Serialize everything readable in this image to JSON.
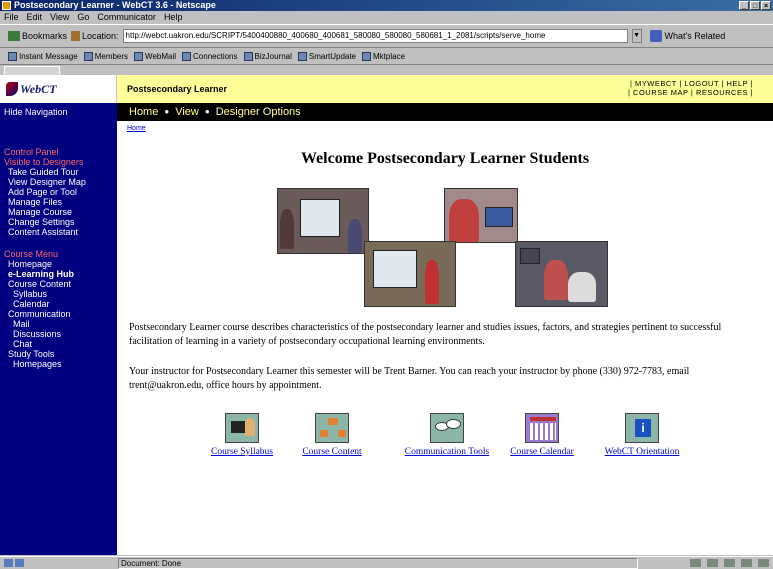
{
  "window": {
    "title": "Postsecondary Learner - WebCT 3.6 - Netscape",
    "buttons": [
      "_",
      "□",
      "×"
    ]
  },
  "menu": [
    "File",
    "Edit",
    "View",
    "Go",
    "Communicator",
    "Help"
  ],
  "location_bar": {
    "bookmarks_label": "Bookmarks",
    "location_label": "Location:",
    "url": "http://webct.uakron.edu/SCRIPT/5400400880_400680_400681_580080_580080_580681_1_2081/scripts/serve_home",
    "related_label": "What's Related"
  },
  "personal_toolbar": [
    "Instant Message",
    "Members",
    "WebMail",
    "Connections",
    "BizJournal",
    "SmartUpdate",
    "Mktplace"
  ],
  "webct": {
    "logo_text": "WebCT",
    "course_title": "Postsecondary Learner",
    "toplinks": {
      "line1": "| MYWEBCT | LOGOUT | HELP |",
      "line2": "| COURSE MAP | RESOURCES |"
    },
    "hide_nav": "Hide Navigation",
    "nav": {
      "home": "Home",
      "view": "View",
      "designer": "Designer Options"
    },
    "crumb": "Home"
  },
  "sidebar": {
    "control_panel": {
      "head1": "Control Panel",
      "head2": "Visible to Designers",
      "items": [
        "Take Guided Tour",
        "View Designer Map",
        "Add Page or Tool",
        "Manage Files",
        "Manage Course",
        "Change Settings",
        "Content Assistant"
      ]
    },
    "course_menu": {
      "head": "Course Menu",
      "homepage": "Homepage",
      "elearning": "e-Learning Hub",
      "course_content": "Course Content",
      "syllabus": "Syllabus",
      "calendar": "Calendar",
      "communication": "Communication",
      "mail": "Mail",
      "discussions": "Discussions",
      "chat": "Chat",
      "study_tools": "Study Tools",
      "homepages": "Homepages"
    }
  },
  "main": {
    "welcome": "Welcome Postsecondary Learner Students",
    "para1": "Postsecondary Learner course describes characteristics of the postsecondary learner and studies issues, factors, and strategies pertinent to successful facilitation of learning in a variety of postsecondary occupational learning environments.",
    "para2": "Your instructor for Postsecondary Learner this semester will be Trent Barner. You can reach your instructor by phone (330) 972-7783, email trent@uakron.edu, office hours by appointment.",
    "tools": [
      {
        "label": "Course Syllabus",
        "icon": "syllabus-icon"
      },
      {
        "label": "Course Content",
        "icon": "content-icon"
      },
      {
        "label": "Communication Tools",
        "icon": "communication-icon"
      },
      {
        "label": "Course Calendar",
        "icon": "calendar-icon"
      },
      {
        "label": "WebCT Orientation",
        "icon": "info-icon"
      }
    ]
  },
  "status": {
    "text": "Document: Done"
  },
  "colors": {
    "sidebar_bg": "#000080",
    "banner_bg": "#ffff99",
    "navbar_bg": "#000000",
    "link": "#0000cc",
    "sidebar_head": "#ff6666"
  }
}
